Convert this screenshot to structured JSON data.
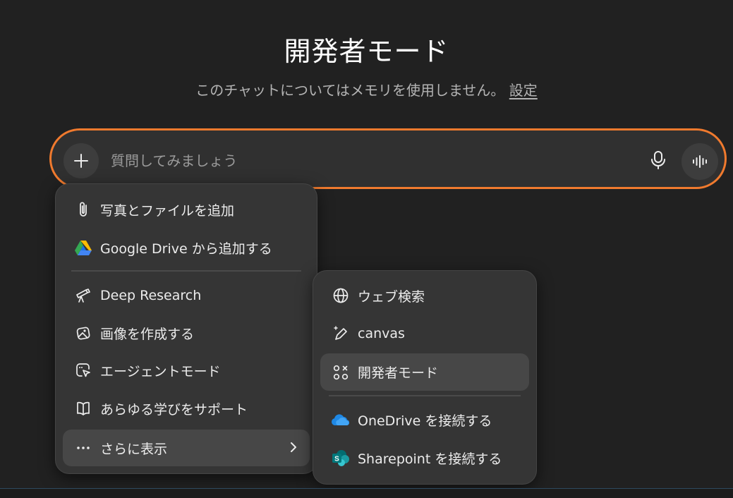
{
  "header": {
    "title": "開発者モード",
    "subtitle_text": "このチャットについてはメモリを使用しません。",
    "settings_link": "設定"
  },
  "composer": {
    "placeholder": "質問してみましょう",
    "accent_color": "#f07a2e"
  },
  "main_menu": {
    "items": [
      {
        "label": "写真とファイルを追加",
        "icon": "paperclip-icon"
      },
      {
        "label": "Google Drive から追加する",
        "icon": "google-drive-icon"
      },
      {
        "label": "Deep Research",
        "icon": "telescope-icon"
      },
      {
        "label": "画像を作成する",
        "icon": "image-create-icon"
      },
      {
        "label": "エージェントモード",
        "icon": "agent-cursor-icon"
      },
      {
        "label": "あらゆる学びをサポート",
        "icon": "book-icon"
      },
      {
        "label": "さらに表示",
        "icon": "more-dots-icon"
      }
    ]
  },
  "sub_menu": {
    "items": [
      {
        "label": "ウェブ検索",
        "icon": "globe-icon"
      },
      {
        "label": "canvas",
        "icon": "pen-sparkle-icon"
      },
      {
        "label": "開発者モード",
        "icon": "developer-icon",
        "selected": true
      },
      {
        "label": "OneDrive を接続する",
        "icon": "onedrive-icon"
      },
      {
        "label": "Sharepoint を接続する",
        "icon": "sharepoint-icon"
      }
    ]
  }
}
